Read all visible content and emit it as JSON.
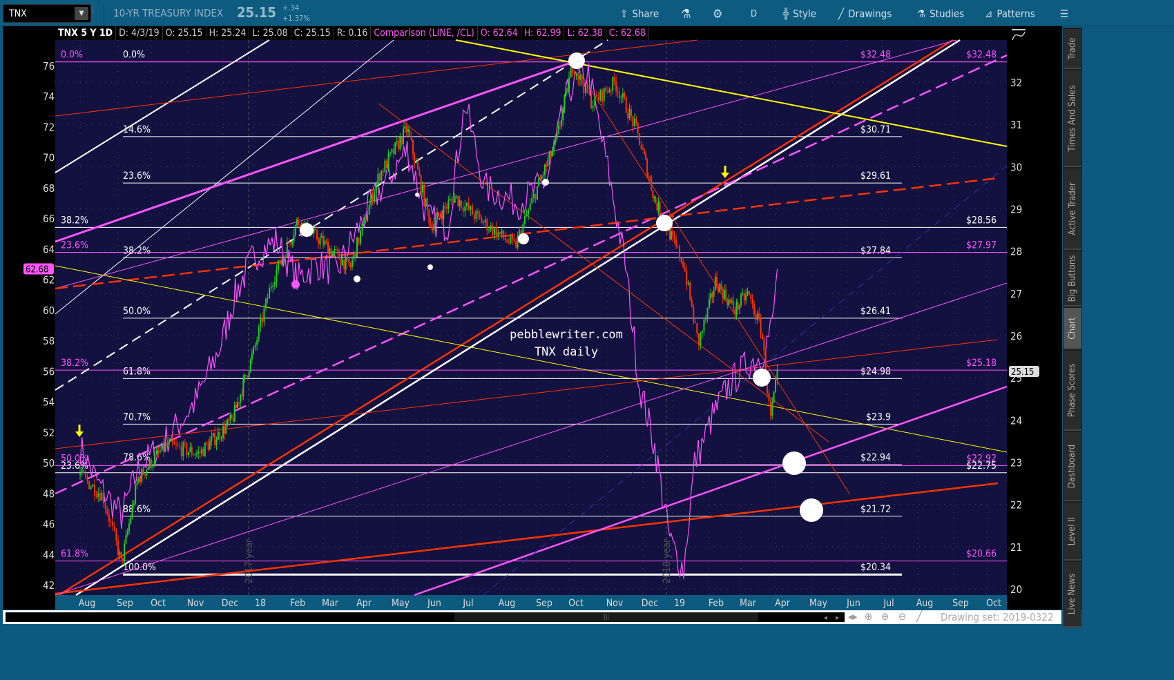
{
  "toolbar": {
    "symbol": "TNX",
    "instrument_title": "10-YR TREASURY INDEX",
    "last": "25.15",
    "change": "+.34",
    "change_pct": "+1.37%",
    "share": "Share",
    "timeframe": "D",
    "style": "Style",
    "drawings": "Drawings",
    "studies": "Studies",
    "patterns": "Patterns"
  },
  "infobar": {
    "series": "TNX 5 Y 1D",
    "date": "D: 4/3/19",
    "open": "O: 25.15",
    "high": "H: 25.24",
    "low": "L: 25.08",
    "close": "C: 25.15",
    "range": "R: 0.16",
    "comparison": "Comparison (LINE, /CL)",
    "c_open": "O: 62.64",
    "c_high": "H: 62.99",
    "c_low": "L: 62.38",
    "c_close": "C: 62.68"
  },
  "side_tabs": [
    "Trade",
    "Times And Sales",
    "Active Trader",
    "Big Buttons",
    "Chart",
    "Phase Scores",
    "Dashboard",
    "Level II",
    "Live News"
  ],
  "bottom": {
    "drawing_set": "Drawing set: 2019-0322"
  },
  "watermark": [
    "pebblewriter.com",
    "TNX daily"
  ],
  "colors": {
    "bg": "#13113f",
    "pink": "#ff55ff",
    "red": "#ff3300",
    "yellow": "#ffff00",
    "green": "#22cc22"
  },
  "chart_data": {
    "type": "candlestick",
    "symbol": "TNX",
    "right_axis": {
      "ticks": [
        20,
        21,
        22,
        23,
        24,
        25,
        26,
        27,
        28,
        29,
        30,
        31,
        32
      ],
      "range": [
        19.9,
        33.0
      ]
    },
    "left_axis": {
      "label": "/CL comparison",
      "ticks": [
        42,
        44,
        46,
        48,
        50,
        52,
        54,
        56,
        58,
        60,
        62,
        64,
        66,
        68,
        70,
        72,
        74,
        76
      ],
      "range": [
        41.6,
        77.5
      ]
    },
    "x_ticks": [
      "Aug",
      "Sep",
      "Oct",
      "Nov",
      "Dec",
      "18",
      "Feb",
      "Mar",
      "Apr",
      "May",
      "Jun",
      "Jul",
      "Aug",
      "Sep",
      "Oct",
      "Nov",
      "Dec",
      "19",
      "Feb",
      "Mar",
      "Apr",
      "May",
      "Jun",
      "Jul",
      "Aug",
      "Sep",
      "Oct"
    ],
    "year_markers": [
      "2017 year",
      "2018 year"
    ],
    "last_price_tag": "25.15",
    "comparison_tag": "62.68",
    "tnx_keypoints_month_value": [
      [
        0,
        22.7
      ],
      [
        0.6,
        22.2
      ],
      [
        1.1,
        20.6
      ],
      [
        1.6,
        22.6
      ],
      [
        2.4,
        23.4
      ],
      [
        3.3,
        23.2
      ],
      [
        4.3,
        24.0
      ],
      [
        5.0,
        25.6
      ],
      [
        5.5,
        27.3
      ],
      [
        6.2,
        28.7
      ],
      [
        7.0,
        28.2
      ],
      [
        7.8,
        27.6
      ],
      [
        8.6,
        29.8
      ],
      [
        9.4,
        30.9
      ],
      [
        10.1,
        28.6
      ],
      [
        10.8,
        29.3
      ],
      [
        11.4,
        28.8
      ],
      [
        12.4,
        28.1
      ],
      [
        13.0,
        29.5
      ],
      [
        13.6,
        30.6
      ],
      [
        14.1,
        32.4
      ],
      [
        14.6,
        31.5
      ],
      [
        15.2,
        32.0
      ],
      [
        15.8,
        30.9
      ],
      [
        16.4,
        29.2
      ],
      [
        16.8,
        28.6
      ],
      [
        17.3,
        27.7
      ],
      [
        17.7,
        25.8
      ],
      [
        18.2,
        27.3
      ],
      [
        18.8,
        26.6
      ],
      [
        19.2,
        27.0
      ],
      [
        19.6,
        26.1
      ],
      [
        19.85,
        24.0
      ],
      [
        20.07,
        25.15
      ]
    ],
    "cl_keypoints_month_value": [
      [
        0,
        51
      ],
      [
        0.5,
        48.5
      ],
      [
        1.1,
        46.5
      ],
      [
        1.6,
        49.5
      ],
      [
        2.4,
        51.5
      ],
      [
        3.2,
        54
      ],
      [
        3.9,
        57.5
      ],
      [
        4.4,
        61
      ],
      [
        5.0,
        63.5
      ],
      [
        5.6,
        64.5
      ],
      [
        6.2,
        62
      ],
      [
        6.8,
        63
      ],
      [
        7.4,
        62.5
      ],
      [
        8.4,
        67
      ],
      [
        9.4,
        70.5
      ],
      [
        10.0,
        66
      ],
      [
        10.6,
        65.5
      ],
      [
        11.1,
        73.5
      ],
      [
        11.6,
        68
      ],
      [
        12.5,
        67
      ],
      [
        13.3,
        68.5
      ],
      [
        14.0,
        74.5
      ],
      [
        14.5,
        75.5
      ],
      [
        15.1,
        68
      ],
      [
        15.5,
        63
      ],
      [
        15.9,
        55
      ],
      [
        16.4,
        51
      ],
      [
        16.9,
        45
      ],
      [
        17.3,
        43
      ],
      [
        17.6,
        50
      ],
      [
        18.1,
        53
      ],
      [
        18.6,
        55
      ],
      [
        19.2,
        56.5
      ],
      [
        19.6,
        57
      ],
      [
        19.9,
        59
      ],
      [
        20.07,
        62.68
      ]
    ],
    "fib_set_1": [
      {
        "pct": "0.0%",
        "price": 32.48,
        "price_label": "$32.48",
        "color": "pink"
      },
      {
        "pct": "14.6%",
        "price": 30.71,
        "price_label": "$30.71",
        "color": "white"
      },
      {
        "pct": "23.6%",
        "price": 29.61,
        "price_label": "$29.61",
        "color": "white"
      },
      {
        "pct": "38.2%",
        "price": 27.84,
        "price_label": "$27.84",
        "color": "white"
      },
      {
        "pct": "50.0%",
        "price": 26.41,
        "price_label": "$26.41",
        "color": "white"
      },
      {
        "pct": "61.8%",
        "price": 24.98,
        "price_label": "$24.98",
        "color": "white"
      },
      {
        "pct": "70.7%",
        "price": 23.9,
        "price_label": "$23.9",
        "color": "white"
      },
      {
        "pct": "78.6%",
        "price": 22.94,
        "price_label": "$22.94",
        "color": "white"
      },
      {
        "pct": "88.6%",
        "price": 21.72,
        "price_label": "$21.72",
        "color": "white"
      },
      {
        "pct": "100.0%",
        "price": 20.34,
        "price_label": "$20.34",
        "color": "white"
      }
    ],
    "fib_set_2": [
      {
        "pct": "0.0%",
        "price": 32.48,
        "price_label": "$32.48",
        "color": "pink"
      },
      {
        "pct": "38.2%",
        "price": 28.56,
        "price_label": "$28.56",
        "color": "white"
      },
      {
        "pct": "23.6%",
        "price": 27.97,
        "price_label": "$27.97",
        "color": "pink"
      },
      {
        "pct": "38.2%",
        "price": 25.18,
        "price_label": "$25.18",
        "color": "pink"
      },
      {
        "pct": "50.0%",
        "price": 22.92,
        "price_label": "$22.92",
        "color": "pink"
      },
      {
        "pct": "23.6%",
        "price": 22.75,
        "price_label": "$22.75",
        "color": "white"
      },
      {
        "pct": "61.8%",
        "price": 20.66,
        "price_label": "$20.66",
        "color": "pink"
      }
    ]
  }
}
